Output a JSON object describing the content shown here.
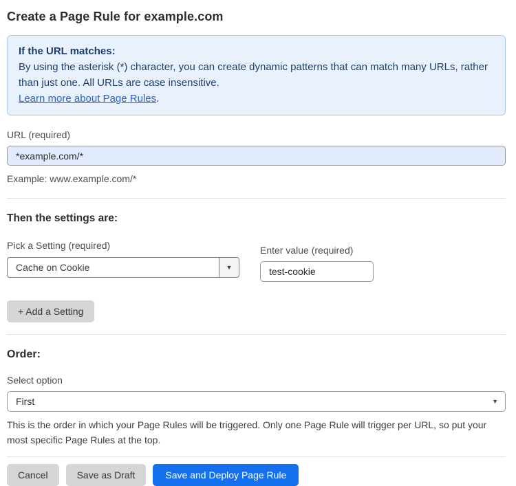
{
  "page": {
    "title": "Create a Page Rule for example.com"
  },
  "info_box": {
    "heading": "If the URL matches:",
    "body": "By using the asterisk (*) character, you can create dynamic patterns that can match many URLs, rather than just one. All URLs are case insensitive.",
    "link_label": "Learn more about Page Rules",
    "link_suffix": "."
  },
  "url_field": {
    "label": "URL (required)",
    "value": "*example.com/*",
    "helper": "Example: www.example.com/*"
  },
  "settings_section": {
    "heading": "Then the settings are:",
    "setting_picker": {
      "label": "Pick a Setting (required)",
      "selected": "Cache on Cookie"
    },
    "value_field": {
      "label": "Enter value (required)",
      "value": "test-cookie"
    },
    "add_setting_label": "+ Add a Setting"
  },
  "order_section": {
    "heading": "Order:",
    "select_label": "Select option",
    "selected": "First",
    "helper": "This is the order in which your Page Rules will be triggered. Only one Page Rule will trigger per URL, so put your most specific Page Rules at the top."
  },
  "footer": {
    "cancel_label": "Cancel",
    "save_draft_label": "Save as Draft",
    "save_deploy_label": "Save and Deploy Page Rule"
  },
  "icons": {
    "dropdown_arrow": "▼"
  },
  "colors": {
    "info_bg": "#e9f1fc",
    "info_border": "#a8c8f0",
    "info_text": "#1c3d6d",
    "link_blue": "#2c62c8",
    "url_input_bg": "#e2ebfb",
    "primary_button_bg": "#1570ef",
    "gray_button_bg": "#d5d5d5"
  }
}
